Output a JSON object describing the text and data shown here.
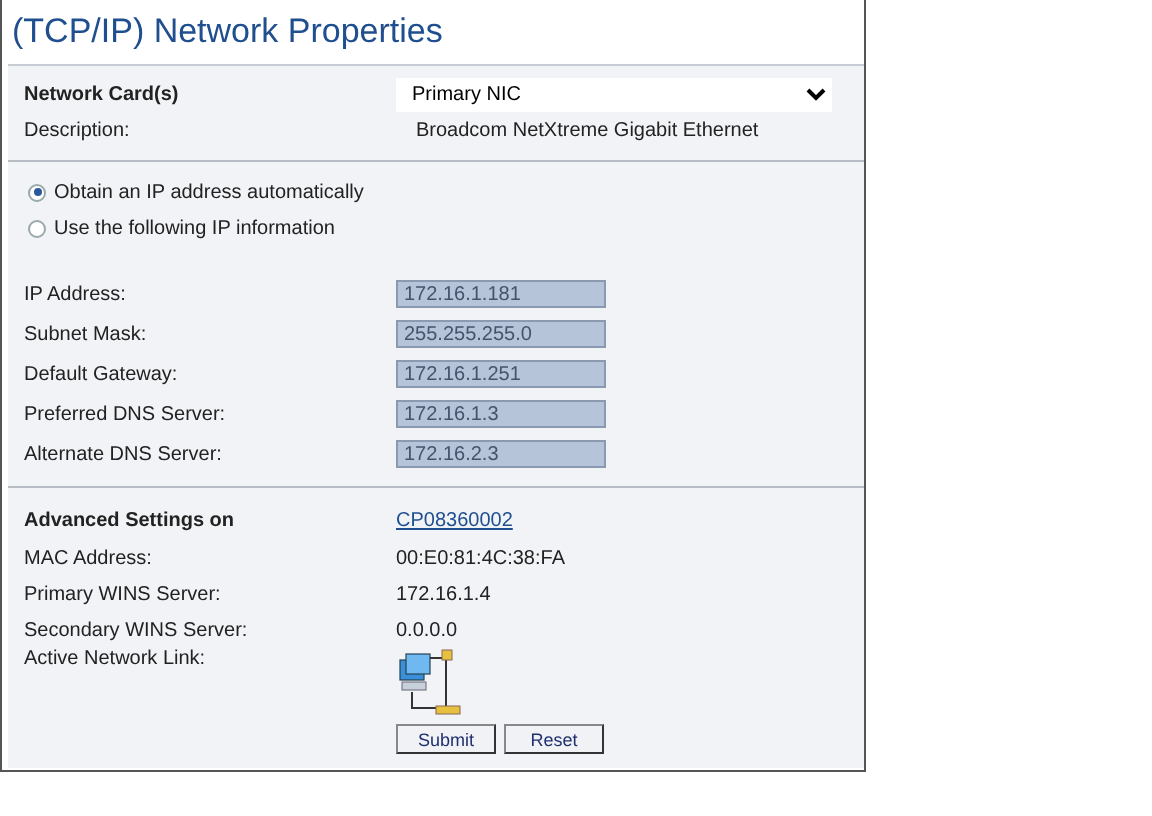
{
  "title": "(TCP/IP) Network Properties",
  "network_card": {
    "label": "Network Card(s)",
    "value": "Primary NIC"
  },
  "description": {
    "label": "Description:",
    "value": "Broadcom NetXtreme Gigabit Ethernet"
  },
  "ip_mode_options": [
    {
      "label": "Obtain an IP address automatically",
      "selected": true
    },
    {
      "label": "Use the following IP information",
      "selected": false
    }
  ],
  "ip_fields": [
    {
      "label": "IP Address:",
      "value": "172.16.1.181",
      "disabled": true
    },
    {
      "label": "Subnet Mask:",
      "value": "255.255.255.0",
      "disabled": true
    },
    {
      "label": "Default Gateway:",
      "value": "172.16.1.251",
      "disabled": true
    },
    {
      "label": "Preferred DNS Server:",
      "value": "172.16.1.3",
      "disabled": true
    },
    {
      "label": "Alternate DNS Server:",
      "value": "172.16.2.3",
      "disabled": true
    }
  ],
  "advanced": {
    "label": "Advanced Settings on",
    "link": "CP08360002"
  },
  "info_rows": [
    {
      "label": "MAC Address:",
      "value": "00:E0:81:4C:38:FA"
    },
    {
      "label": "Primary WINS Server:",
      "value": "172.16.1.4"
    },
    {
      "label": "Secondary WINS Server:",
      "value": "0.0.0.0"
    }
  ],
  "active_link": {
    "label": "Active Network Link:"
  },
  "buttons": [
    "Submit",
    "Reset"
  ]
}
